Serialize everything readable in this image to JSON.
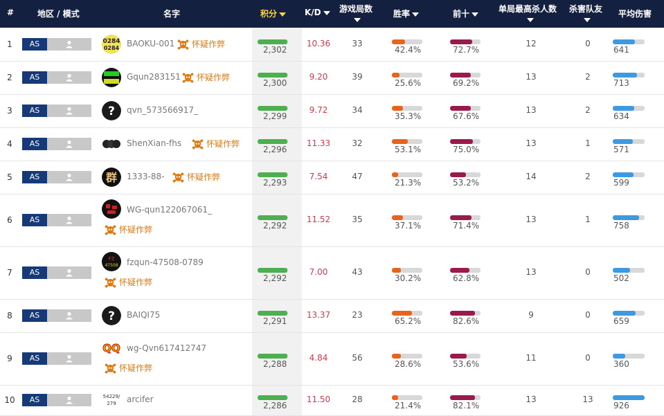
{
  "headers": {
    "rank": "#",
    "region": "地区 / 模式",
    "name": "名字",
    "score": "积分",
    "kd": "K/D",
    "games": "游戏局数",
    "win": "胜率",
    "top10": "前十",
    "maxkills": "单局最高杀人数",
    "teamkills": "杀害队友",
    "avgdmg": "平均伤害"
  },
  "cheat_label": "怀疑作弊",
  "region_label": "AS",
  "colors": {
    "header_bg": "#142040",
    "active_sort": "#ffd640",
    "score_bar": "#4caf50",
    "win_bar": "#e8641c",
    "top10_bar": "#9a1a4e",
    "dmg_bar": "#3d9ae0",
    "kd_text": "#d2384e",
    "cheat_text": "#e07a10"
  },
  "rows": [
    {
      "rank": "1",
      "name": "BAOKU-001",
      "cheat": true,
      "cheat_below": false,
      "avatar": "0284-icon",
      "score": "2,302",
      "score_pct": 0.98,
      "kd": "10.36",
      "games": "33",
      "win": "42.4%",
      "win_pct": 0.424,
      "top10": "72.7%",
      "top10_pct": 0.727,
      "maxkills": "12",
      "teamkills": "0",
      "dmg": "641",
      "dmg_pct": 0.69
    },
    {
      "rank": "2",
      "name": "Gqun283151",
      "cheat": true,
      "cheat_below": false,
      "avatar": "green-text-icon",
      "score": "2,300",
      "score_pct": 0.98,
      "kd": "9.20",
      "games": "39",
      "win": "25.6%",
      "win_pct": 0.256,
      "top10": "69.2%",
      "top10_pct": 0.692,
      "maxkills": "13",
      "teamkills": "2",
      "dmg": "713",
      "dmg_pct": 0.77
    },
    {
      "rank": "3",
      "name": "qvn_573566917_",
      "cheat": false,
      "cheat_below": false,
      "avatar": "question-icon",
      "score": "2,299",
      "score_pct": 0.98,
      "kd": "9.72",
      "games": "34",
      "win": "35.3%",
      "win_pct": 0.353,
      "top10": "67.6%",
      "top10_pct": 0.676,
      "maxkills": "13",
      "teamkills": "2",
      "dmg": "634",
      "dmg_pct": 0.68
    },
    {
      "rank": "4",
      "name": "ShenXian-fhs",
      "cheat": true,
      "cheat_below": false,
      "avatar": "three-faces-icon",
      "score": "2,296",
      "score_pct": 0.98,
      "kd": "11.33",
      "games": "32",
      "win": "53.1%",
      "win_pct": 0.531,
      "top10": "75.0%",
      "top10_pct": 0.75,
      "maxkills": "13",
      "teamkills": "1",
      "dmg": "571",
      "dmg_pct": 0.62
    },
    {
      "rank": "5",
      "name": "1333-88-",
      "cheat": true,
      "cheat_below": false,
      "avatar": "qun-char-icon",
      "score": "2,293",
      "score_pct": 0.97,
      "kd": "7.54",
      "games": "47",
      "win": "21.3%",
      "win_pct": 0.213,
      "top10": "53.2%",
      "top10_pct": 0.532,
      "maxkills": "14",
      "teamkills": "2",
      "dmg": "599",
      "dmg_pct": 0.65
    },
    {
      "rank": "6",
      "name": "WG-qun122067061_",
      "cheat": true,
      "cheat_below": true,
      "avatar": "red-glyph-icon",
      "score": "2,292",
      "score_pct": 0.97,
      "kd": "11.52",
      "games": "35",
      "win": "37.1%",
      "win_pct": 0.371,
      "top10": "71.4%",
      "top10_pct": 0.714,
      "maxkills": "13",
      "teamkills": "1",
      "dmg": "758",
      "dmg_pct": 0.82
    },
    {
      "rank": "7",
      "name": "fzqun-47508-0789",
      "cheat": true,
      "cheat_below": true,
      "avatar": "fzqun-icon",
      "score": "2,292",
      "score_pct": 0.97,
      "kd": "7.00",
      "games": "43",
      "win": "30.2%",
      "win_pct": 0.302,
      "top10": "62.8%",
      "top10_pct": 0.628,
      "maxkills": "13",
      "teamkills": "0",
      "dmg": "502",
      "dmg_pct": 0.54
    },
    {
      "rank": "8",
      "name": "BAIQI75",
      "cheat": false,
      "cheat_below": false,
      "avatar": "question-icon",
      "score": "2,291",
      "score_pct": 0.97,
      "kd": "13.37",
      "games": "23",
      "win": "65.2%",
      "win_pct": 0.652,
      "top10": "82.6%",
      "top10_pct": 0.826,
      "maxkills": "9",
      "teamkills": "0",
      "dmg": "659",
      "dmg_pct": 0.71
    },
    {
      "rank": "9",
      "name": "wg-Qvn617412747",
      "cheat": true,
      "cheat_below": true,
      "avatar": "qq-icon",
      "score": "2,288",
      "score_pct": 0.97,
      "kd": "4.84",
      "games": "56",
      "win": "28.6%",
      "win_pct": 0.286,
      "top10": "53.6%",
      "top10_pct": 0.536,
      "maxkills": "11",
      "teamkills": "0",
      "dmg": "360",
      "dmg_pct": 0.39
    },
    {
      "rank": "10",
      "name": "arcifer",
      "cheat": false,
      "cheat_below": false,
      "avatar": "number-icon",
      "avatar_text": "54229/ 279",
      "score": "2,286",
      "score_pct": 0.97,
      "kd": "11.50",
      "games": "28",
      "win": "21.4%",
      "win_pct": 0.214,
      "top10": "82.1%",
      "top10_pct": 0.821,
      "maxkills": "13",
      "teamkills": "13",
      "dmg": "926",
      "dmg_pct": 1.0
    }
  ]
}
